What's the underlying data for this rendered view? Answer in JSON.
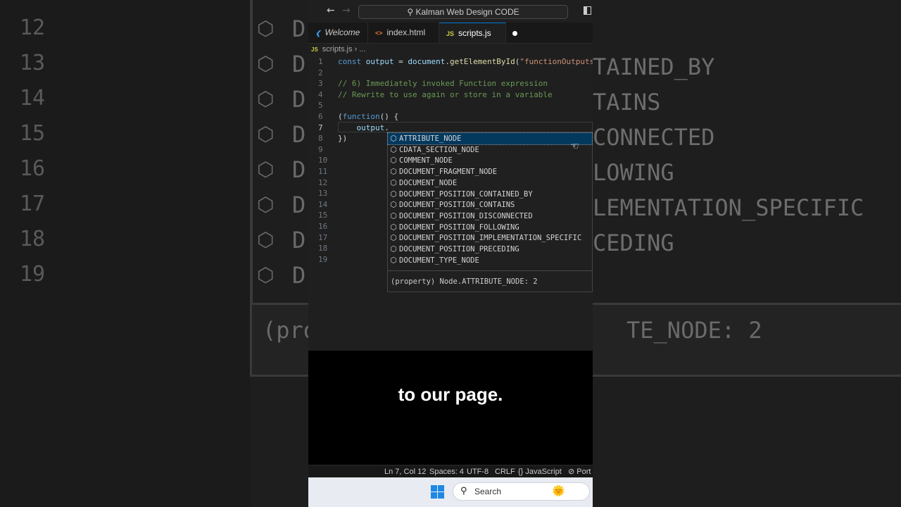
{
  "window": {
    "command_center": "Kalman Web Design CODE",
    "back_icon": "arrow-left-icon",
    "forward_icon": "arrow-right-icon"
  },
  "tabs": [
    {
      "label": "Welcome",
      "icon": "vscode-icon"
    },
    {
      "label": "index.html",
      "icon": "html-icon"
    },
    {
      "label": "scripts.js",
      "icon": "js-icon",
      "modified": true
    }
  ],
  "breadcrumb": {
    "file": "scripts.js",
    "rest": "..."
  },
  "code_lines": [
    "const output = document.getElementById(\"functionOutputs\")",
    "",
    "// 6) Immediately invoked Function expression",
    "// Rewrite to use again or store in a variable",
    "",
    "(function() {",
    "    output.",
    "})",
    "",
    "",
    "",
    "",
    "",
    "",
    "",
    "",
    "",
    "",
    ""
  ],
  "line_numbers": [
    "1",
    "2",
    "3",
    "4",
    "5",
    "6",
    "7",
    "8",
    "9",
    "10",
    "11",
    "12",
    "13",
    "14",
    "15",
    "16",
    "17",
    "18",
    "19"
  ],
  "current_line": 7,
  "suggestions": [
    "ATTRIBUTE_NODE",
    "CDATA_SECTION_NODE",
    "COMMENT_NODE",
    "DOCUMENT_FRAGMENT_NODE",
    "DOCUMENT_NODE",
    "DOCUMENT_POSITION_CONTAINED_BY",
    "DOCUMENT_POSITION_CONTAINS",
    "DOCUMENT_POSITION_DISCONNECTED",
    "DOCUMENT_POSITION_FOLLOWING",
    "DOCUMENT_POSITION_IMPLEMENTATION_SPECIFIC",
    "DOCUMENT_POSITION_PRECEDING",
    "DOCUMENT_TYPE_NODE"
  ],
  "suggestion_detail": "(property) Node.ATTRIBUTE_NODE: 2",
  "caption": "to our page.",
  "status": {
    "position": "Ln 7, Col 12",
    "spaces": "Spaces: 4",
    "encoding": "UTF-8",
    "eol": "CRLF",
    "language": "{} JavaScript",
    "port": "Port"
  },
  "taskbar": {
    "search_placeholder": "Search"
  },
  "background": {
    "left_numbers": [
      "12",
      "13",
      "14",
      "15",
      "16",
      "17",
      "18",
      "19"
    ],
    "right_fragments": [
      "TAINED_BY",
      "TAINS",
      "CONNECTED",
      "LOWING",
      "LEMENTATION_SPECIFIC",
      "CEDING"
    ],
    "bottom_left": "(pro",
    "bottom_right": "TE_NODE: 2"
  },
  "colors": {
    "accent": "#0078d4",
    "selection": "#04395e",
    "comment": "#6a9955",
    "keyword": "#569cd6"
  }
}
